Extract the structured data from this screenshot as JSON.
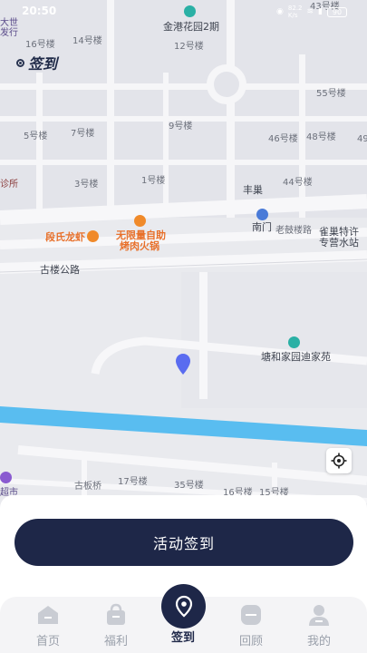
{
  "status_bar": {
    "time": "20:50",
    "net_speed_top": "82.2",
    "net_speed_bottom": "K/s",
    "battery": "90"
  },
  "brand": {
    "title": "签到"
  },
  "map": {
    "labels": {
      "da_shi": "大世",
      "fa_xing": "发行",
      "jingang": "金港花园2期",
      "b16": "16号楼",
      "b14": "14号楼",
      "b12": "12号楼",
      "b43": "43号楼",
      "b55": "55号楼",
      "b5": "5号楼",
      "b7": "7号楼",
      "b9": "9号楼",
      "b46": "46号楼",
      "b48": "48号楼",
      "b49": "49",
      "zhensuo": "诊所",
      "b3": "3号楼",
      "b1": "1号楼",
      "fengchao": "丰巢",
      "b44": "44号楼",
      "nanmen": "南门",
      "laogulou": "老鼓楼路",
      "quechao1": "雀巢特许",
      "quechao2": "专营水站",
      "duanshi": "段氏龙虾",
      "wuxian1": "无限量自助",
      "wuxian2": "烤肉火锅",
      "gulou_road": "古楼公路",
      "tanghe": "塘和家园迪家苑",
      "guban": "古板桥",
      "b17": "17号楼",
      "b35": "35号楼",
      "b16b": "16号楼",
      "b15": "15号楼",
      "chaoshi": "超市"
    }
  },
  "actions": {
    "checkin_label": "活动签到"
  },
  "tabs": [
    {
      "label": "首页",
      "icon": "home-icon"
    },
    {
      "label": "福利",
      "icon": "bag-icon"
    },
    {
      "label": "签到",
      "icon": "location-pin-icon"
    },
    {
      "label": "回顾",
      "icon": "review-icon"
    },
    {
      "label": "我的",
      "icon": "user-icon"
    }
  ],
  "colors": {
    "primary": "#1e2748",
    "river": "#59bdf0",
    "map_bg": "#e9eaee"
  }
}
